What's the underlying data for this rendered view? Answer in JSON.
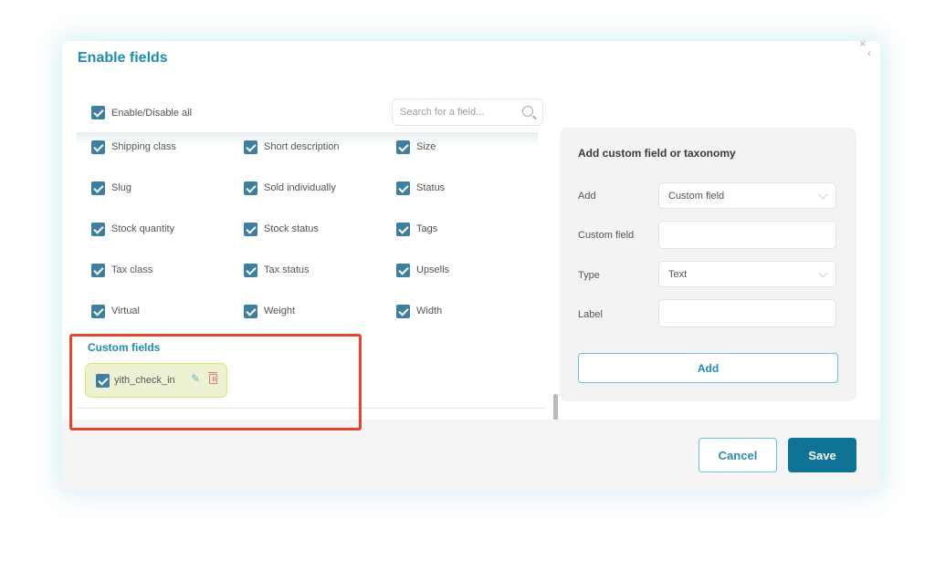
{
  "dialog": {
    "title": "Enable fields",
    "close_icon": "close-icon"
  },
  "toolbar": {
    "enable_all_label": "Enable/Disable all",
    "enable_all_checked": true,
    "search_placeholder": "Search for a field...",
    "search_value": ""
  },
  "fields": [
    {
      "label": "Shipping class",
      "checked": true
    },
    {
      "label": "Short description",
      "checked": true
    },
    {
      "label": "Size",
      "checked": true
    },
    {
      "label": "Slug",
      "checked": true
    },
    {
      "label": "Sold individually",
      "checked": true
    },
    {
      "label": "Status",
      "checked": true
    },
    {
      "label": "Stock quantity",
      "checked": true
    },
    {
      "label": "Stock status",
      "checked": true
    },
    {
      "label": "Tags",
      "checked": true
    },
    {
      "label": "Tax class",
      "checked": true
    },
    {
      "label": "Tax status",
      "checked": true
    },
    {
      "label": "Upsells",
      "checked": true
    },
    {
      "label": "Virtual",
      "checked": true
    },
    {
      "label": "Weight",
      "checked": true
    },
    {
      "label": "Width",
      "checked": true
    }
  ],
  "custom_fields": {
    "title": "Custom fields",
    "items": [
      {
        "label": "yith_check_in",
        "checked": true,
        "edit_icon": "pencil-icon",
        "delete_icon": "trash-icon"
      }
    ]
  },
  "add_panel": {
    "title": "Add custom field or taxonomy",
    "add_label": "Add",
    "add_value": "Custom field",
    "custom_field_label": "Custom field",
    "custom_field_value": "",
    "type_label": "Type",
    "type_value": "Text",
    "label_label": "Label",
    "label_value": "",
    "add_button": "Add"
  },
  "footer": {
    "cancel": "Cancel",
    "save": "Save"
  },
  "colors": {
    "accent": "#1f8db0",
    "primary_button": "#0f7396",
    "checkbox": "#3e7f9f",
    "highlight": "#e2462a",
    "custom_chip_bg": "#eef2d3"
  }
}
